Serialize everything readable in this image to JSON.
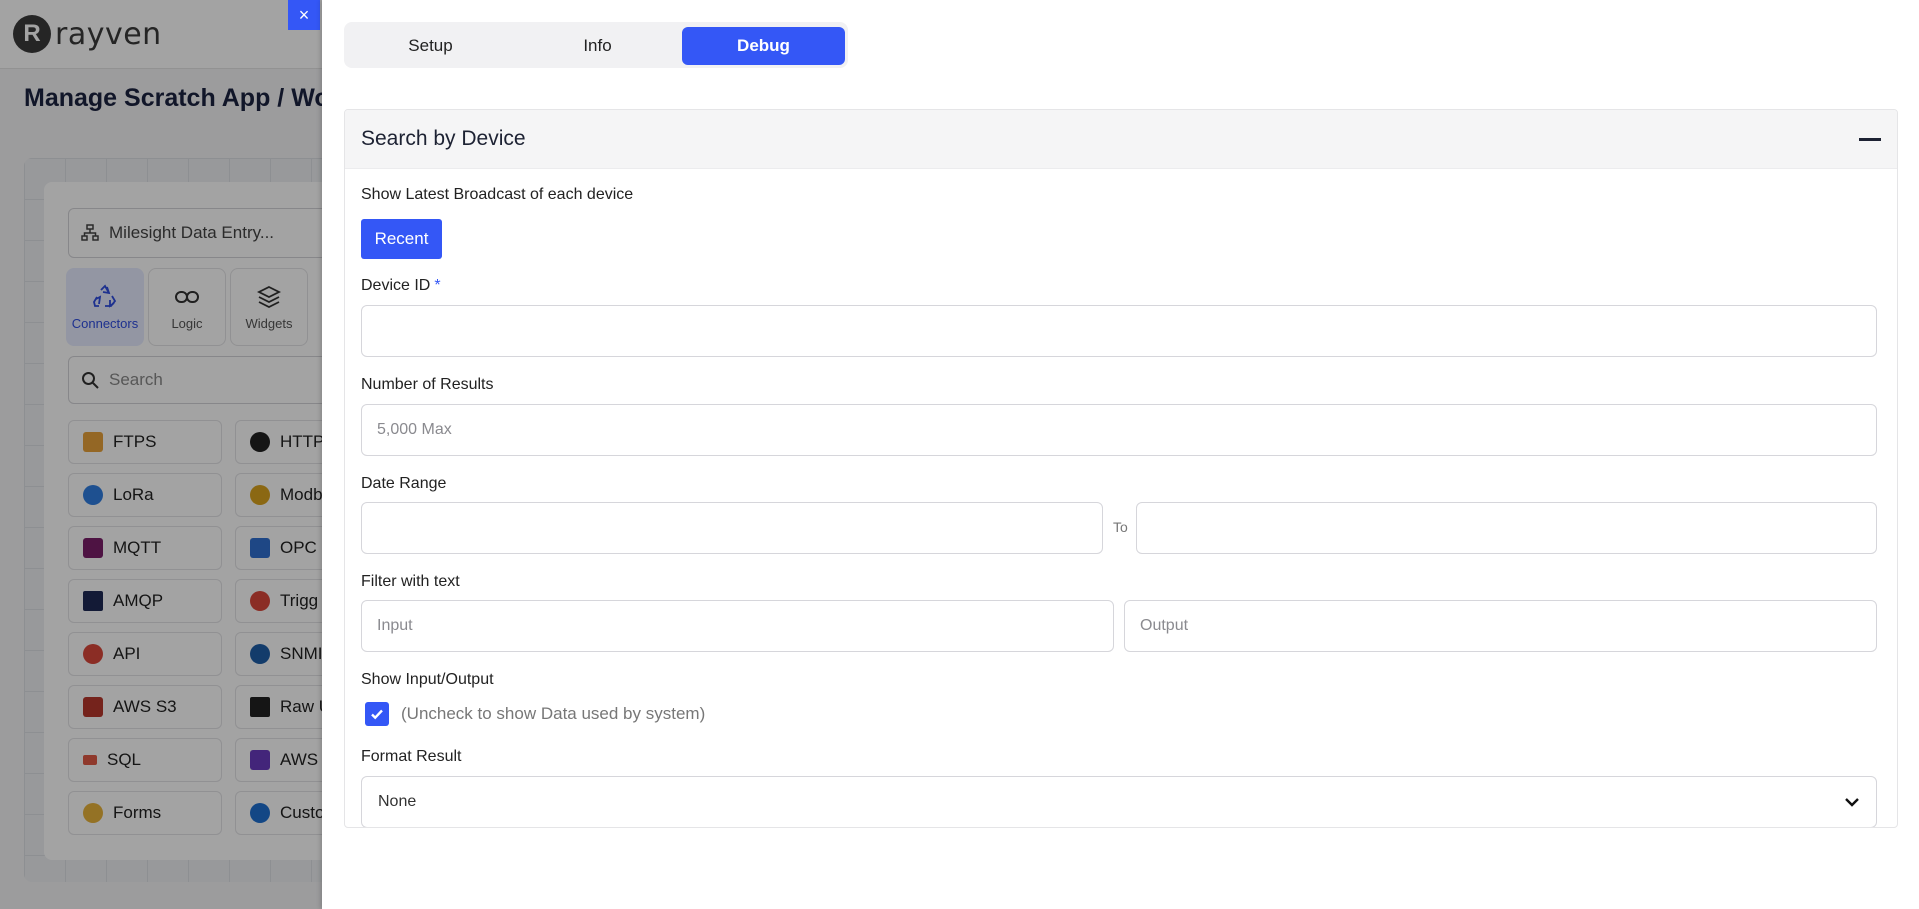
{
  "app": {
    "logo_mark": "R",
    "logo_text": "rayven",
    "page_title": "Manage Scratch App / Work",
    "flow_name": "Milesight Data Entry...",
    "categories": [
      {
        "label": "Connectors",
        "icon": "recycle-icon"
      },
      {
        "label": "Logic",
        "icon": "link-icon"
      },
      {
        "label": "Widgets",
        "icon": "layers-icon"
      }
    ],
    "search_placeholder": "Search",
    "connectors_left": [
      "FTPS",
      "LoRa",
      "MQTT",
      "AMQP",
      "API",
      "AWS S3",
      "SQL",
      "Forms"
    ],
    "connectors_right": [
      "HTTP",
      "Modb",
      "OPC",
      "Trigg",
      "SNMI",
      "Raw U",
      "AWS",
      "Custo"
    ]
  },
  "drawer": {
    "close_label": "×",
    "tabs": [
      "Setup",
      "Info",
      "Debug"
    ],
    "active_tab": "Debug",
    "panel": {
      "title": "Search by Device",
      "show_latest_label": "Show Latest Broadcast of each device",
      "recent_label": "Recent",
      "device_id_label": "Device ID",
      "required_mark": "*",
      "device_id_value": "",
      "number_of_results_label": "Number of Results",
      "number_of_results_placeholder": "5,000 Max",
      "date_range_label": "Date Range",
      "date_from_value": "",
      "to_label": "To",
      "date_to_value": "",
      "filter_label": "Filter with text",
      "input_placeholder": "Input",
      "output_placeholder": "Output",
      "show_io_label": "Show Input/Output",
      "show_io_checked": true,
      "show_io_hint": "(Uncheck to show Data used by system)",
      "format_result_label": "Format Result",
      "format_result_value": "None"
    }
  },
  "colors": {
    "accent": "#3457f6"
  }
}
